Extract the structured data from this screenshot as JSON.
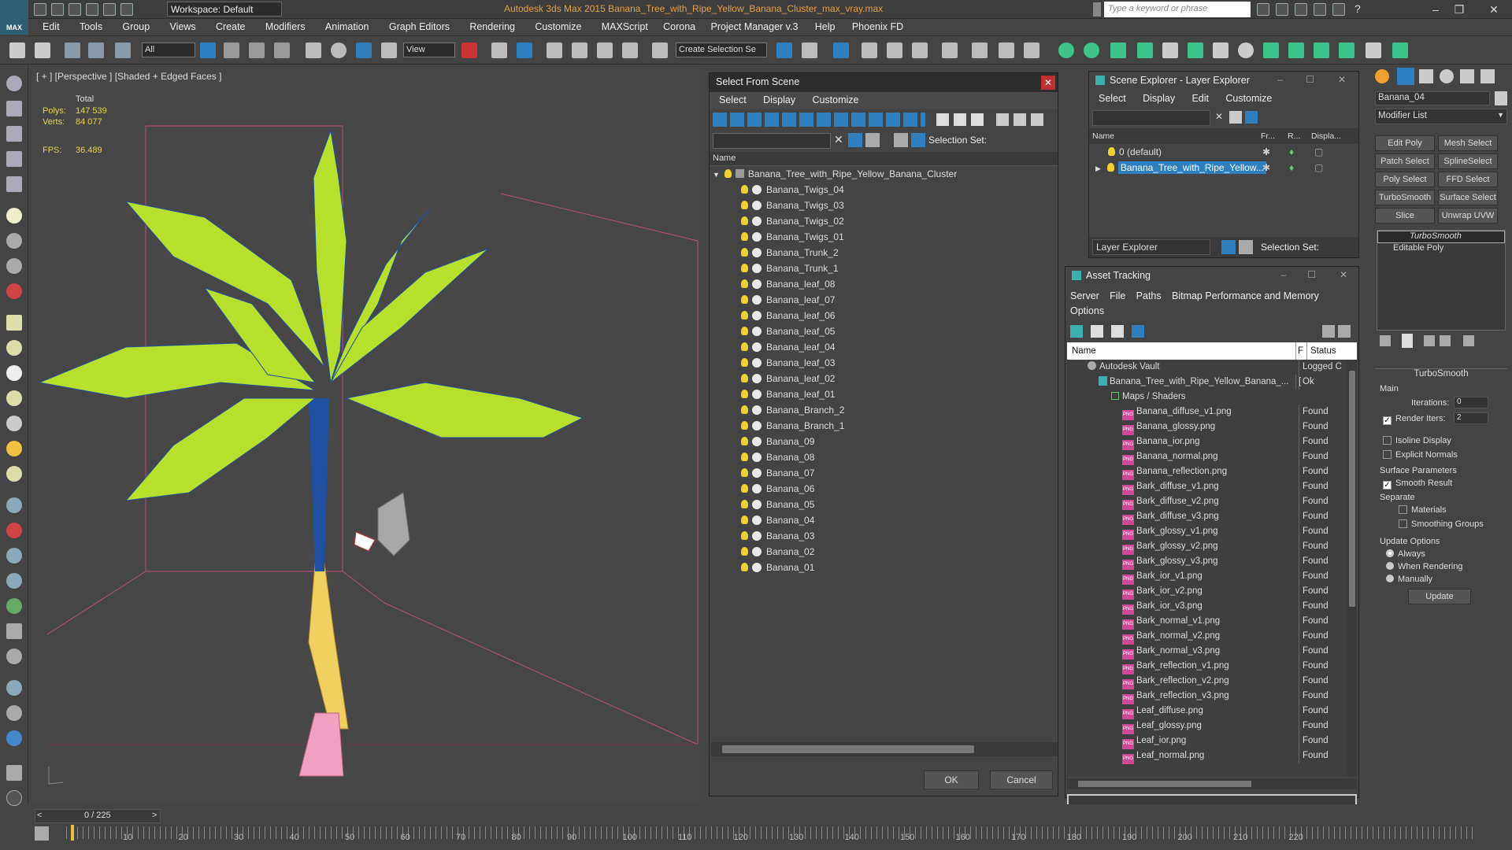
{
  "app": {
    "logo_label": "MAX",
    "workspace": "Workspace: Default",
    "title": "Autodesk 3ds Max  2015      Banana_Tree_with_Ripe_Yellow_Banana_Cluster_max_vray.max",
    "search_placeholder": "Type a keyword or phrase"
  },
  "menu": [
    "Edit",
    "Tools",
    "Group",
    "Views",
    "Create",
    "Modifiers",
    "Animation",
    "Graph Editors",
    "Rendering",
    "Customize",
    "MAXScript",
    "Corona",
    "Project Manager v.3",
    "Help",
    "Phoenix FD"
  ],
  "toolbar": {
    "filter": "All",
    "refcoord": "View",
    "selset": "Create Selection Se"
  },
  "viewport": {
    "label": "[ + ] [Perspective ] [Shaded + Edged Faces ]",
    "total_label": "Total",
    "polys_label": "Polys:",
    "polys": "147 539",
    "verts_label": "Verts:",
    "verts": "84 077",
    "fps_label": "FPS:",
    "fps": "36.489"
  },
  "sfs": {
    "title": "Select From Scene",
    "menu": [
      "Select",
      "Display",
      "Customize"
    ],
    "selection_set_label": "Selection Set:",
    "name_header": "Name",
    "root": "Banana_Tree_with_Ripe_Yellow_Banana_Cluster",
    "items": [
      "Banana_Twigs_04",
      "Banana_Twigs_03",
      "Banana_Twigs_02",
      "Banana_Twigs_01",
      "Banana_Trunk_2",
      "Banana_Trunk_1",
      "Banana_leaf_08",
      "Banana_leaf_07",
      "Banana_leaf_06",
      "Banana_leaf_05",
      "Banana_leaf_04",
      "Banana_leaf_03",
      "Banana_leaf_02",
      "Banana_leaf_01",
      "Banana_Branch_2",
      "Banana_Branch_1",
      "Banana_09",
      "Banana_08",
      "Banana_07",
      "Banana_06",
      "Banana_05",
      "Banana_04",
      "Banana_03",
      "Banana_02",
      "Banana_01"
    ],
    "ok": "OK",
    "cancel": "Cancel"
  },
  "se": {
    "title": "Scene Explorer - Layer Explorer",
    "menu": [
      "Select",
      "Display",
      "Edit",
      "Customize"
    ],
    "col_name": "Name",
    "col_fr": "Fr...",
    "col_r": "R...",
    "col_disp": "Displa...",
    "layers": [
      "0 (default)",
      "Banana_Tree_with_Ripe_Yellow..."
    ],
    "footer_combo": "Layer Explorer",
    "selection_set_label": "Selection Set:"
  },
  "at": {
    "title": "Asset Tracking",
    "menu": [
      "Server",
      "File",
      "Paths",
      "Bitmap Performance and Memory",
      "Options"
    ],
    "col_name": "Name",
    "col_f": "F",
    "col_status": "Status",
    "vault": "Autodesk Vault",
    "vault_status": "Logged C",
    "file": "Banana_Tree_with_Ripe_Yellow_Banana_...",
    "file_flag": "[",
    "file_status": "Ok",
    "maps": "Maps / Shaders",
    "assets": [
      "Banana_diffuse_v1.png",
      "Banana_glossy.png",
      "Banana_ior.png",
      "Banana_normal.png",
      "Banana_reflection.png",
      "Bark_diffuse_v1.png",
      "Bark_diffuse_v2.png",
      "Bark_diffuse_v3.png",
      "Bark_glossy_v1.png",
      "Bark_glossy_v2.png",
      "Bark_glossy_v3.png",
      "Bark_ior_v1.png",
      "Bark_ior_v2.png",
      "Bark_ior_v3.png",
      "Bark_normal_v1.png",
      "Bark_normal_v2.png",
      "Bark_normal_v3.png",
      "Bark_reflection_v1.png",
      "Bark_reflection_v2.png",
      "Bark_reflection_v3.png",
      "Leaf_diffuse.png",
      "Leaf_glossy.png",
      "Leaf_ior.png",
      "Leaf_normal.png"
    ],
    "asset_status": "Found",
    "png_badge": "PNG"
  },
  "cmd": {
    "object_name": "Banana_04",
    "modifier_list": "Modifier List",
    "buttons": [
      "Edit Poly",
      "Mesh Select",
      "Patch Select",
      "SplineSelect",
      "Poly Select",
      "FFD Select",
      "TurboSmooth",
      "Surface Select",
      "Slice",
      "Unwrap UVW"
    ],
    "stack": [
      "TurboSmooth",
      "Editable Poly"
    ],
    "rollout": "TurboSmooth",
    "main": "Main",
    "iterations_label": "Iterations:",
    "iterations": "0",
    "render_iters_label": "Render Iters:",
    "render_iters": "2",
    "isoline": "Isoline Display",
    "explicit_normals": "Explicit Normals",
    "surface_params": "Surface Parameters",
    "smooth_result": "Smooth Result",
    "separate": "Separate",
    "materials": "Materials",
    "smoothing_groups": "Smoothing Groups",
    "update_options": "Update Options",
    "always": "Always",
    "when_rendering": "When Rendering",
    "manually": "Manually",
    "update": "Update"
  },
  "timeline": {
    "frame": "0 / 225",
    "ticks": [
      "10",
      "20",
      "30",
      "40",
      "50",
      "60",
      "70",
      "80",
      "90",
      "100",
      "110",
      "120",
      "130",
      "140",
      "150",
      "160",
      "170",
      "180",
      "190",
      "200",
      "210",
      "220"
    ]
  },
  "colors": {
    "accent": "#2d7fc0",
    "leaf": "#b6e02c",
    "trunk": "#e8c050",
    "title_orange": "#e8a040"
  }
}
